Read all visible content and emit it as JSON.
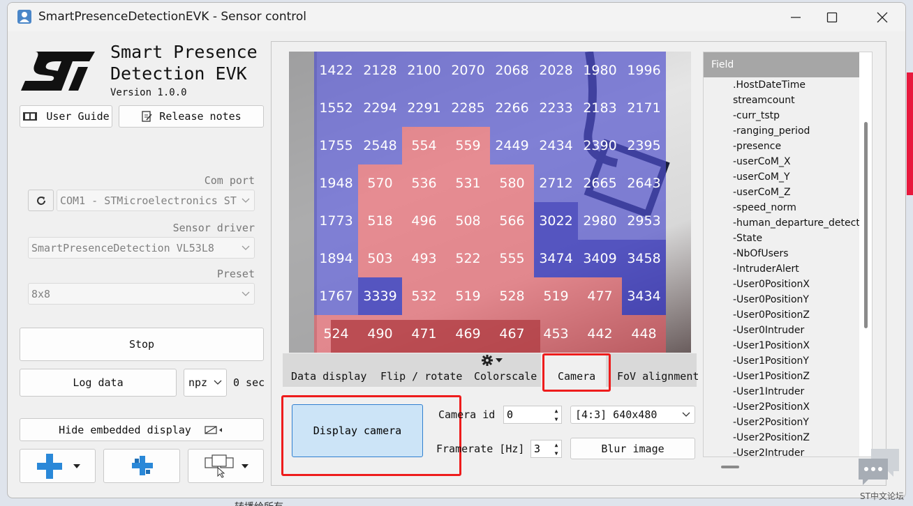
{
  "window": {
    "title": "SmartPresenceDetectionEVK - Sensor control",
    "app_icon": "person-icon",
    "controls": {
      "minimize_icon": "minimize-icon",
      "maximize_icon": "maximize-icon",
      "close_icon": "close-icon"
    }
  },
  "branding": {
    "logo": "st-logo",
    "title_line1": "Smart Presence",
    "title_line2": "Detection EVK",
    "version": "Version 1.0.0"
  },
  "buttons": {
    "user_guide": "User Guide",
    "release_notes": "Release notes",
    "stop": "Stop",
    "log_data": "Log data",
    "hide_display": "Hide embedded display",
    "display_camera": "Display camera",
    "blur_image": "Blur image"
  },
  "com": {
    "label": "Com port",
    "value": "COM1 - STMicroelectronics ST",
    "refresh_icon": "refresh-icon"
  },
  "sensor_driver": {
    "label": "Sensor driver",
    "value": "SmartPresenceDetection VL53L8"
  },
  "preset": {
    "label": "Preset",
    "value": "8x8"
  },
  "log": {
    "format": "npz",
    "elapsed": "0 sec"
  },
  "heatmap": {
    "rows": [
      [
        "1422",
        "2128",
        "2100",
        "2070",
        "2068",
        "2028",
        "1980",
        "1996"
      ],
      [
        "1552",
        "2294",
        "2291",
        "2285",
        "2266",
        "2233",
        "2183",
        "2171"
      ],
      [
        "1755",
        "2548",
        "554",
        "559",
        "2449",
        "2434",
        "2390",
        "2395"
      ],
      [
        "1948",
        "570",
        "536",
        "531",
        "580",
        "2712",
        "2665",
        "2643"
      ],
      [
        "1773",
        "518",
        "496",
        "508",
        "566",
        "3022",
        "2980",
        "2953"
      ],
      [
        "1894",
        "503",
        "493",
        "522",
        "555",
        "3474",
        "3409",
        "3458"
      ],
      [
        "1767",
        "3339",
        "532",
        "519",
        "528",
        "519",
        "477",
        "3434"
      ],
      [
        "524",
        "490",
        "471",
        "469",
        "467",
        "453",
        "442",
        "448"
      ]
    ],
    "colors": {
      "near": "#e6555f",
      "far": "#5050cd",
      "farthest": "#3737b9"
    }
  },
  "tabs": [
    "Data display",
    "Flip / rotate",
    "Colorscale",
    "Camera",
    "FoV alignment"
  ],
  "active_tab": "Camera",
  "camera": {
    "id_label": "Camera id",
    "id_value": "0",
    "resolution": "[4:3] 640x480",
    "framerate_label": "Framerate [Hz]",
    "framerate_value": "3"
  },
  "field_panel": {
    "header": "Field",
    "items": [
      ".HostDateTime",
      "streamcount",
      "-curr_tstp",
      "-ranging_period",
      "-presence",
      "-userCoM_X",
      "-userCoM_Y",
      "-userCoM_Z",
      "-speed_norm",
      "-human_departure_detecte",
      "-State",
      "-NbOfUsers",
      "-IntruderAlert",
      "-User0PositionX",
      "-User0PositionY",
      "-User0PositionZ",
      "-User0Intruder",
      "-User1PositionX",
      "-User1PositionY",
      "-User1PositionZ",
      "-User1Intruder",
      "-User2PositionX",
      "-User2PositionY",
      "-User2PositionZ",
      "-User2Intruder"
    ]
  },
  "desktop": {
    "watermark": "ST中文论坛",
    "bottom_text": "转播给所有"
  }
}
